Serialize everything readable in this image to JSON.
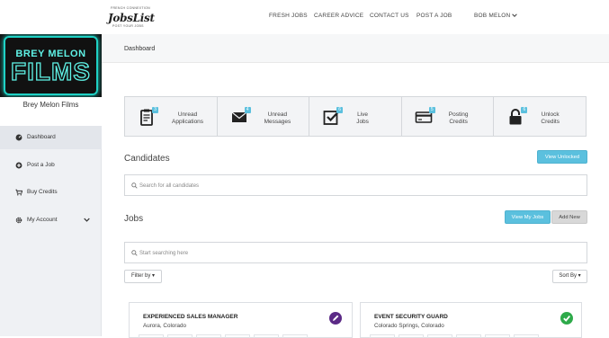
{
  "logo": {
    "brand": "JobsList",
    "tag_top": "FRENCH CONNEXTION",
    "tag_bottom": "POST YOUR JOBS"
  },
  "nav": {
    "items": [
      "FRESH JOBS",
      "CAREER ADVICE",
      "CONTACT US",
      "POST A JOB"
    ],
    "user": "BOB MELON",
    "user_icon": "chevron-down-icon"
  },
  "sidebar": {
    "banner_line1": "BREY MELON",
    "banner_line2": "FILMS",
    "company_name": "Brey Melon Films",
    "items": [
      {
        "label": "Dashboard",
        "icon": "dashboard-icon"
      },
      {
        "label": "Post a Job",
        "icon": "plus-circle-icon"
      },
      {
        "label": "Buy Credits",
        "icon": "cart-icon"
      },
      {
        "label": "My Account",
        "icon": "gear-icon"
      }
    ]
  },
  "header": {
    "title": "Dashboard"
  },
  "stats": [
    {
      "label1": "Unread",
      "label2": "Applications",
      "count": "3",
      "icon": "clipboard-icon"
    },
    {
      "label1": "Unread",
      "label2": "Messages",
      "count": "4",
      "icon": "envelope-icon"
    },
    {
      "label1": "Live",
      "label2": "Jobs",
      "count": "6",
      "icon": "checkbox-icon"
    },
    {
      "label1": "Posting",
      "label2": "Credits",
      "count": "5",
      "icon": "credit-card-icon"
    },
    {
      "label1": "Unlock",
      "label2": "Credits",
      "count": "6",
      "icon": "lock-icon"
    }
  ],
  "candidates": {
    "title": "Candidates",
    "view_unlocked": "View Unlocked",
    "search_placeholder": "Search for all candidates"
  },
  "jobs": {
    "title": "Jobs",
    "view_my_jobs": "View My Jobs",
    "add_new": "Add New",
    "search_placeholder": "Start searching here",
    "filter_by": "Filter by",
    "sort_by": "Sort By",
    "cards": [
      {
        "title": "EXPERIENCED SALES MANAGER",
        "location": "Aurora, Colorado",
        "status_icon": "edit-icon",
        "status_color": "#5b2a86"
      },
      {
        "title": "EVENT SECURITY GUARD",
        "location": "Colorado Springs, Colorado",
        "status_icon": "check-icon",
        "status_color": "#2eaa4a"
      }
    ]
  },
  "colors": {
    "accent": "#5bc0de",
    "sidebar_bg": "#eff1f4",
    "banner_neon": "#5ff2e6"
  }
}
